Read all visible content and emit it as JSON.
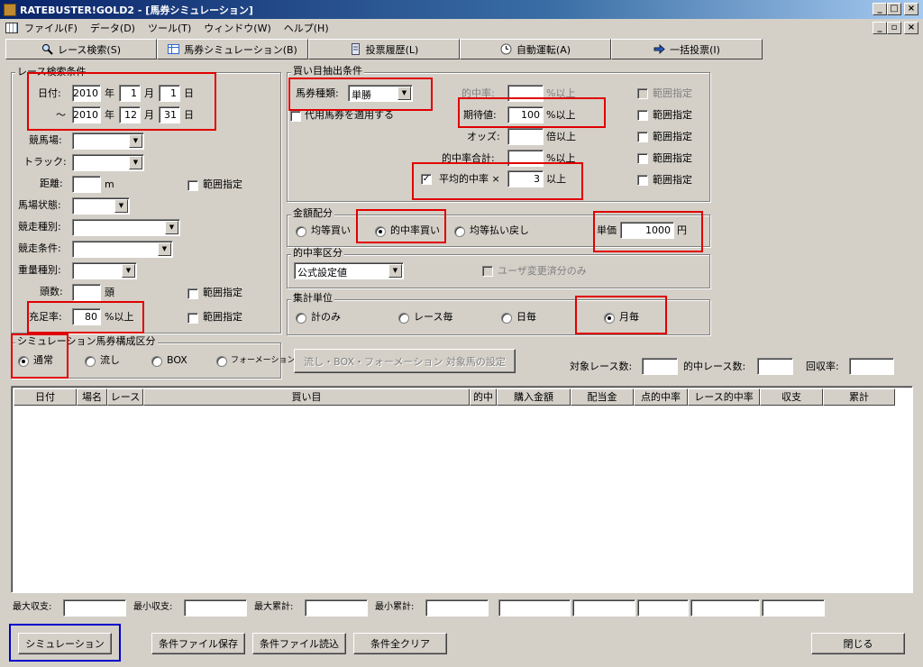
{
  "window": {
    "title": "RATEBUSTER!GOLD2 - [馬券シミュレーション]"
  },
  "menu": [
    "ファイル(F)",
    "データ(D)",
    "ツール(T)",
    "ウィンドウ(W)",
    "ヘルプ(H)"
  ],
  "toolbar": [
    "レース検索(S)",
    "馬券シミュレーション(B)",
    "投票履歴(L)",
    "自動運転(A)",
    "一括投票(I)"
  ],
  "race_search": {
    "title": "レース検索条件",
    "date_label": "日付:",
    "from": {
      "year": "2010",
      "month": "1",
      "day": "1"
    },
    "to_prefix": "～",
    "to": {
      "year": "2010",
      "month": "12",
      "day": "31"
    },
    "year_unit": "年",
    "month_unit": "月",
    "day_unit": "日",
    "track_label": "競馬場:",
    "course_label": "トラック:",
    "distance_label": "距離:",
    "distance_unit": "m",
    "condition_label": "馬場状態:",
    "race_type_label": "競走種別:",
    "race_cond_label": "競走条件:",
    "weight_label": "重量種別:",
    "heads_label": "頭数:",
    "heads_unit": "頭",
    "fill_label": "充足率:",
    "fill_value": "80",
    "fill_unit": "%以上",
    "range_label": "範囲指定"
  },
  "sim_type": {
    "title": "シミュレーション馬券構成区分",
    "options": [
      "通常",
      "流し",
      "BOX",
      "フォーメーション"
    ],
    "selected": 0
  },
  "bet_extract": {
    "title": "買い目抽出条件",
    "ticket_label": "馬券種類:",
    "ticket_value": "単勝",
    "hit_label": "的中率:",
    "hit_unit": "%以上",
    "substitute_label": "代用馬券を適用する",
    "ev_label": "期待値:",
    "ev_value": "100",
    "ev_unit": "%以上",
    "odds_label": "オッズ:",
    "odds_unit": "倍以上",
    "hit_total_label": "的中率合計:",
    "hit_total_unit": "%以上",
    "avg_label": "平均的中率 ×",
    "avg_value": "3",
    "avg_unit": "以上",
    "range_label": "範囲指定"
  },
  "amount": {
    "title": "金額配分",
    "options": [
      "均等買い",
      "的中率買い",
      "均等払い戻し"
    ],
    "selected": 1,
    "unit_label": "単価",
    "unit_value": "1000",
    "unit_suffix": "円"
  },
  "hit_class": {
    "title": "的中率区分",
    "value": "公式設定値",
    "user_only_label": "ユーザ変更済分のみ"
  },
  "agg": {
    "title": "集計単位",
    "options": [
      "計のみ",
      "レース毎",
      "日毎",
      "月毎"
    ],
    "selected": 3
  },
  "target_button": "流し・BOX・フォーメーション 対象馬の設定",
  "stats": {
    "target_races": "対象レース数:",
    "hit_races": "的中レース数:",
    "return_rate": "回収率:"
  },
  "grid": {
    "columns": [
      "日付",
      "場名",
      "レース",
      "買い目",
      "的中",
      "購入金額",
      "配当金",
      "点的中率",
      "レース的中率",
      "収支",
      "累計"
    ]
  },
  "summary": {
    "max_balance": "最大収支:",
    "min_balance": "最小収支:",
    "max_cum": "最大累計:",
    "min_cum": "最小累計:"
  },
  "buttons": {
    "simulate": "シミュレーション",
    "save": "条件ファイル保存",
    "load": "条件ファイル読込",
    "clear": "条件全クリア",
    "close": "閉じる"
  }
}
